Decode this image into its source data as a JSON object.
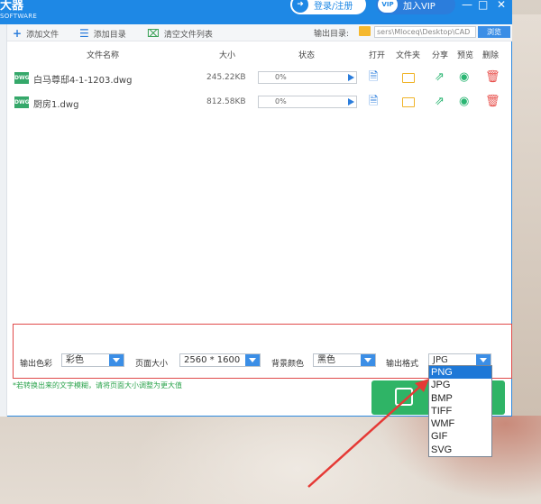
{
  "app": {
    "brand_line1": "大器",
    "brand_line2": "SOFTWARE",
    "login_label": "登录/注册",
    "vip_badge": "VIP",
    "vip_label": "加入VIP",
    "minimize": "—",
    "maximize": "□",
    "close": "✕"
  },
  "toolbar": {
    "add_file": "添加文件",
    "add_folder": "添加目录",
    "clear_list": "清空文件列表",
    "output_dir_label": "输出目录:",
    "output_path": "sers\\Mloceq\\Desktop\\CAD",
    "browse": "浏览"
  },
  "table": {
    "headers": [
      "文件名称",
      "大小",
      "状态",
      "打开",
      "文件夹",
      "分享",
      "预览",
      "删除"
    ],
    "rows": [
      {
        "icon": "DWG",
        "name": "白马尊邸4-1-1203.dwg",
        "size": "245.22KB",
        "progress": "0%"
      },
      {
        "icon": "DWG",
        "name": "厨房1.dwg",
        "size": "812.58KB",
        "progress": "0%"
      }
    ]
  },
  "settings": {
    "color_label": "输出色彩",
    "color_value": "彩色",
    "page_size_label": "页面大小",
    "page_size_value": "2560 * 1600",
    "bg_color_label": "背景颜色",
    "bg_color_value": "黑色",
    "format_label": "输出格式",
    "format_value": "JPG"
  },
  "hint": "*若转换出来的文字模糊，请将页面大小调整为更大值",
  "format_options": [
    "PNG",
    "JPG",
    "BMP",
    "TIFF",
    "WMF",
    "GIF",
    "SVG"
  ],
  "format_selected_index": 0,
  "colors": {
    "titlebar": "#1e88e5",
    "accent": "#3b8ee6",
    "convert": "#2fb466",
    "highlight_border": "#e04a4a",
    "annotation_arrow": "#e53935"
  }
}
